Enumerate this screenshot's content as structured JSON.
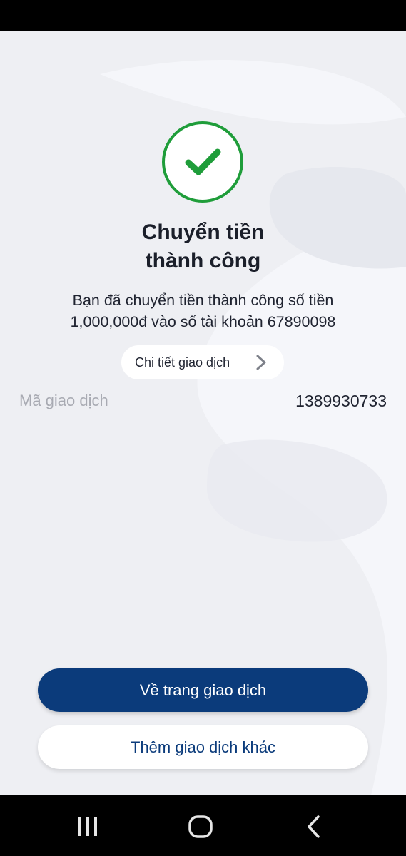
{
  "result": {
    "title_line1": "Chuyển tiền",
    "title_line2": "thành công",
    "message_line1": "Bạn đã chuyển tiền thành công số tiền",
    "message_line2": "1,000,000đ vào số tài khoản 67890098",
    "status_icon": "check-circle-icon",
    "accent_color": "#1f9d3a"
  },
  "detail_chip": {
    "label": "Chi tiết giao dịch",
    "icon": "chevron-right-icon"
  },
  "transaction": {
    "id_label": "Mã giao dịch",
    "id_value": "1389930733"
  },
  "actions": {
    "primary_label": "Về trang giao dịch",
    "secondary_label": "Thêm giao dịch khác",
    "primary_color": "#0b3b7b"
  },
  "system_nav": {
    "recents_icon": "recents-icon",
    "home_icon": "home-icon",
    "back_icon": "back-icon"
  }
}
